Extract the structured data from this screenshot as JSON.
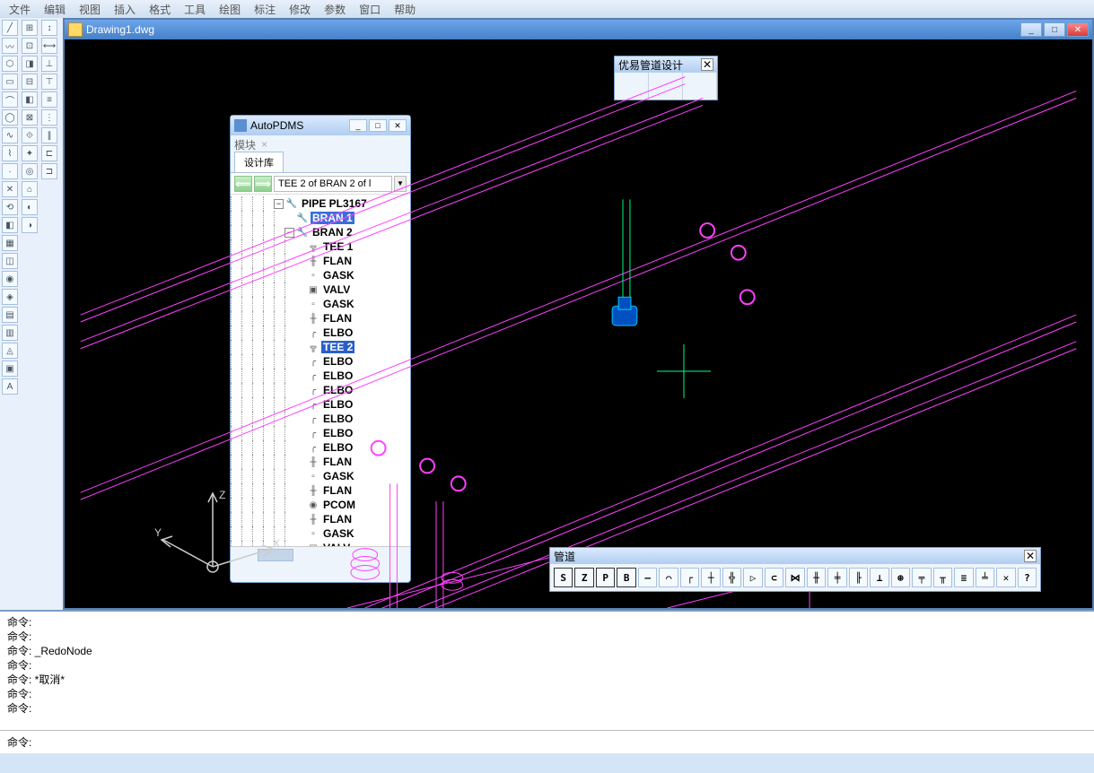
{
  "menubar": [
    "文件",
    "编辑",
    "视图",
    "插入",
    "格式",
    "工具",
    "绘图",
    "标注",
    "修改",
    "参数",
    "窗口",
    "帮助"
  ],
  "drawing": {
    "title": "Drawing1.dwg"
  },
  "float_top": {
    "title": "优易管道设计"
  },
  "pdms": {
    "title": "AutoPDMS",
    "tab_mod": "模块",
    "tab_lib": "设计库",
    "path": "TEE 2 of BRAN 2 of l",
    "tree": [
      {
        "depth": 0,
        "exp": "-",
        "icon": "pipe",
        "label": "PIPE PL3167",
        "sel": false
      },
      {
        "depth": 1,
        "exp": "",
        "icon": "wrench",
        "label": "BRAN 1",
        "sel": true
      },
      {
        "depth": 1,
        "exp": "-",
        "icon": "wrench",
        "label": "BRAN 2",
        "sel": false
      },
      {
        "depth": 2,
        "exp": "",
        "icon": "tee",
        "label": "TEE 1",
        "sel": false
      },
      {
        "depth": 2,
        "exp": "",
        "icon": "flan",
        "label": "FLAN",
        "sel": false
      },
      {
        "depth": 2,
        "exp": "",
        "icon": "gask",
        "label": "GASK",
        "sel": false
      },
      {
        "depth": 2,
        "exp": "",
        "icon": "valv",
        "label": "VALV",
        "sel": false
      },
      {
        "depth": 2,
        "exp": "",
        "icon": "gask",
        "label": "GASK",
        "sel": false
      },
      {
        "depth": 2,
        "exp": "",
        "icon": "flan",
        "label": "FLAN",
        "sel": false
      },
      {
        "depth": 2,
        "exp": "",
        "icon": "elbo",
        "label": "ELBO",
        "sel": false
      },
      {
        "depth": 2,
        "exp": "",
        "icon": "tee",
        "label": "TEE 2",
        "sel": false,
        "hot": true
      },
      {
        "depth": 2,
        "exp": "",
        "icon": "elbo",
        "label": "ELBO",
        "sel": false
      },
      {
        "depth": 2,
        "exp": "",
        "icon": "elbo",
        "label": "ELBO",
        "sel": false
      },
      {
        "depth": 2,
        "exp": "",
        "icon": "elbo",
        "label": "ELBO",
        "sel": false
      },
      {
        "depth": 2,
        "exp": "",
        "icon": "elbo",
        "label": "ELBO",
        "sel": false
      },
      {
        "depth": 2,
        "exp": "",
        "icon": "elbo",
        "label": "ELBO",
        "sel": false
      },
      {
        "depth": 2,
        "exp": "",
        "icon": "elbo",
        "label": "ELBO",
        "sel": false
      },
      {
        "depth": 2,
        "exp": "",
        "icon": "elbo",
        "label": "ELBO",
        "sel": false
      },
      {
        "depth": 2,
        "exp": "",
        "icon": "flan",
        "label": "FLAN",
        "sel": false
      },
      {
        "depth": 2,
        "exp": "",
        "icon": "gask",
        "label": "GASK",
        "sel": false
      },
      {
        "depth": 2,
        "exp": "",
        "icon": "flan",
        "label": "FLAN",
        "sel": false
      },
      {
        "depth": 2,
        "exp": "",
        "icon": "pcom",
        "label": "PCOM",
        "sel": false
      },
      {
        "depth": 2,
        "exp": "",
        "icon": "flan",
        "label": "FLAN",
        "sel": false
      },
      {
        "depth": 2,
        "exp": "",
        "icon": "gask",
        "label": "GASK",
        "sel": false
      },
      {
        "depth": 2,
        "exp": "",
        "icon": "valv",
        "label": "VALV",
        "sel": false
      }
    ]
  },
  "pipetb": {
    "title": "管道",
    "buttons": [
      "S",
      "Z",
      "P",
      "B",
      "—",
      "⌒",
      "┌",
      "┼",
      "╬",
      "▷",
      "⊂",
      "⋈",
      "╫",
      "╪",
      "╟",
      "⊥",
      "⊛",
      "╤",
      "╥",
      "≡",
      "╧",
      "✕",
      "?"
    ]
  },
  "axis": {
    "x": "X",
    "y": "Y",
    "z": "Z"
  },
  "cmd": {
    "prompt": "命令:",
    "history": [
      "命令:",
      "命令:",
      "命令: _RedoNode",
      "命令:",
      "命令: *取消*",
      "命令:",
      "命令:"
    ],
    "input": ""
  }
}
